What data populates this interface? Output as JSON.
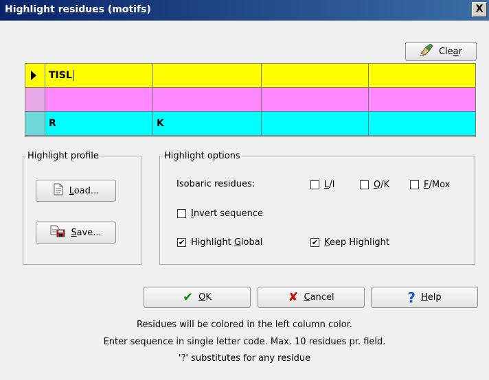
{
  "window": {
    "title": "Highlight residues (motifs)",
    "close_label": "X"
  },
  "toolbar": {
    "clear_label": "Clear",
    "clear_mnemonic": "a"
  },
  "grid": {
    "rows": [
      {
        "color": "#ffff00",
        "indicator_color": "#ffff00",
        "cells": [
          "TISL",
          "",
          "",
          ""
        ]
      },
      {
        "color": "#ff88ff",
        "indicator_color": "#e8a8e8",
        "cells": [
          "",
          "",
          "",
          ""
        ]
      },
      {
        "color": "#00ffff",
        "indicator_color": "#6fd8d8",
        "cells": [
          "R",
          "K",
          "",
          ""
        ]
      }
    ]
  },
  "profile": {
    "legend": "Highlight profile",
    "load_label": "Load...",
    "save_label": "Save..."
  },
  "options": {
    "legend": "Highlight options",
    "isobaric_label": "Isobaric residues:",
    "li_label": "L/I",
    "li_checked": false,
    "qk_label": "Q/K",
    "qk_checked": false,
    "fmox_label": "F/Mox",
    "fmox_checked": false,
    "invert_label": "Invert sequence",
    "invert_checked": false,
    "global_label": "Highlight Global",
    "global_checked": true,
    "keep_label": "Keep Highlight",
    "keep_checked": true
  },
  "buttons": {
    "ok_label": "OK",
    "cancel_label": "Cancel",
    "help_label": "Help"
  },
  "notes": {
    "line1": "Residues will be colored in the left column color.",
    "line2": "Enter sequence in single letter code. Max. 10 residues pr. field.",
    "line3": "'?' substitutes for any residue"
  }
}
